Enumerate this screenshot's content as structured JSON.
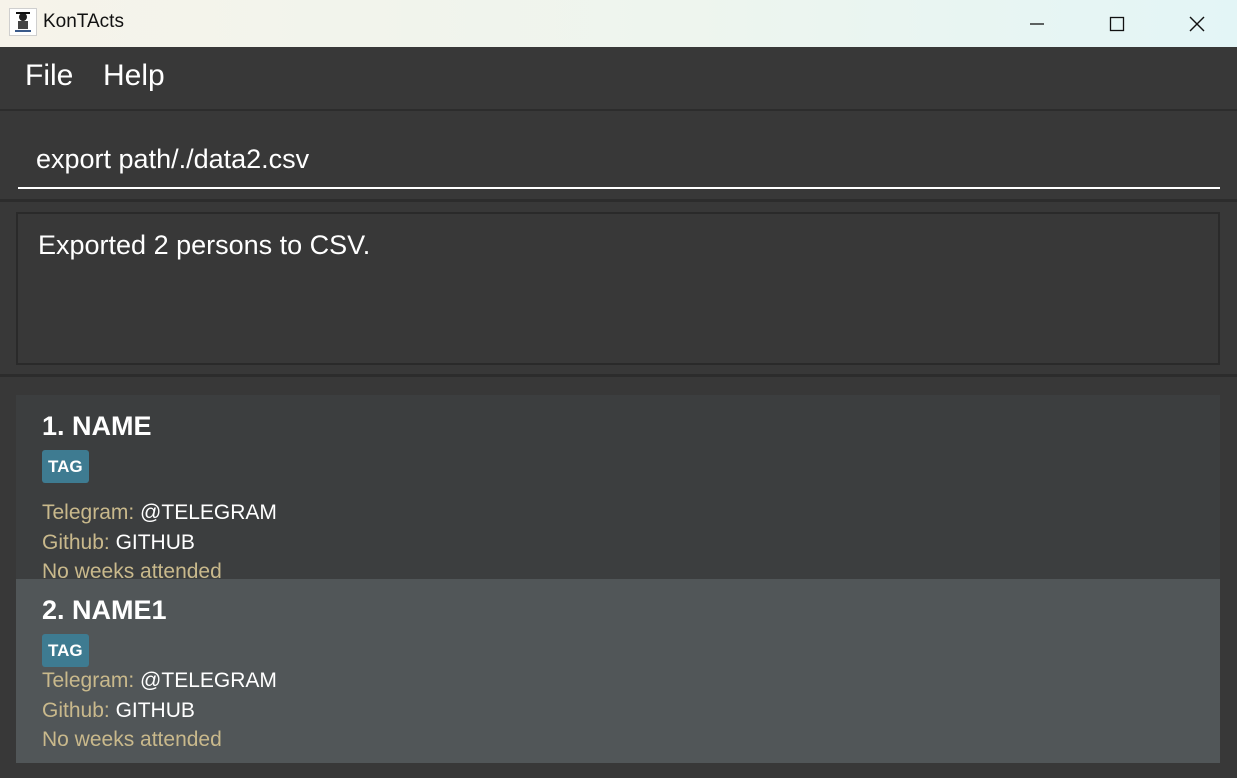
{
  "window": {
    "title": "KonTActs",
    "icon": "app-logo-icon",
    "controls": [
      "minimize-icon",
      "maximize-icon",
      "close-icon"
    ]
  },
  "menu": {
    "file_label": "File",
    "help_label": "Help"
  },
  "command": {
    "value": "export path/./data2.csv"
  },
  "result": {
    "message": "Exported 2 persons to CSV."
  },
  "persons": [
    {
      "title": "1. NAME",
      "tag": "TAG",
      "telegram_label": "Telegram:",
      "telegram_value": "@TELEGRAM",
      "github_label": "Github:",
      "github_value": "GITHUB",
      "weeks": "No weeks attended"
    },
    {
      "title": "2. NAME1",
      "tag": "TAG",
      "telegram_label": "Telegram:",
      "telegram_value": "@TELEGRAM",
      "github_label": "Github:",
      "github_value": "GITHUB",
      "weeks": "No weeks attended"
    }
  ],
  "colors": {
    "background": "#383838",
    "card_odd": "#3c3e3f",
    "card_even": "#515658",
    "tag": "#3e7b91",
    "label": "#c9b98c"
  }
}
